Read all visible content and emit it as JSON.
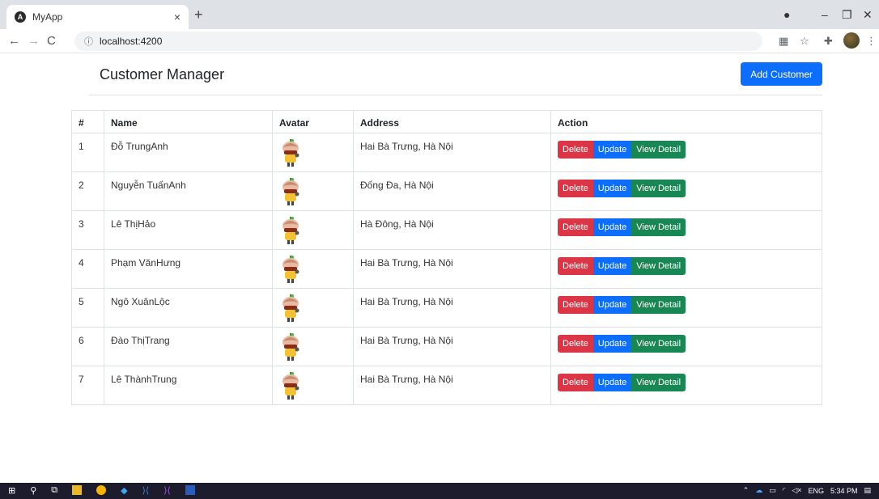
{
  "browser": {
    "tab_title": "MyApp",
    "tab_close": "×",
    "new_tab": "+",
    "url": "localhost:4200",
    "window_controls": [
      "–",
      "❐",
      "✕"
    ]
  },
  "page": {
    "title": "Customer Manager",
    "add_button_label": "Add Customer",
    "columns": [
      "#",
      "Name",
      "Avatar",
      "Address",
      "Action"
    ],
    "action_labels": {
      "delete": "Delete",
      "update": "Update",
      "view": "View Detail"
    },
    "rows": [
      {
        "num": "1",
        "name": "Đỗ TrungAnh",
        "address": "Hai Bà Trưng, Hà Nội"
      },
      {
        "num": "2",
        "name": "Nguyễn TuấnAnh",
        "address": "Đống Đa, Hà Nội"
      },
      {
        "num": "3",
        "name": "Lê ThịHảo",
        "address": "Hà Đông, Hà Nội"
      },
      {
        "num": "4",
        "name": "Phạm VănHưng",
        "address": "Hai Bà Trưng, Hà Nội"
      },
      {
        "num": "5",
        "name": "Ngô XuânLộc",
        "address": "Hai Bà Trưng, Hà Nội"
      },
      {
        "num": "6",
        "name": "Đào ThịTrang",
        "address": "Hai Bà Trưng, Hà Nội"
      },
      {
        "num": "7",
        "name": "Lê ThànhTrung",
        "address": "Hai Bà Trưng, Hà Nội"
      }
    ]
  },
  "taskbar": {
    "lang": "ENG",
    "time": "5:34 PM"
  },
  "colors": {
    "primary": "#0d6efd",
    "danger": "#dc3545",
    "success": "#198754"
  }
}
